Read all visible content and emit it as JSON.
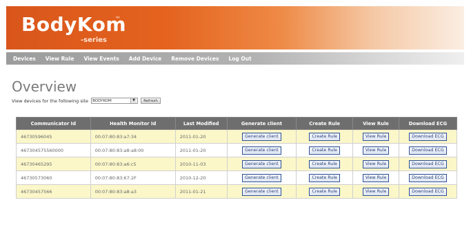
{
  "brand": {
    "name": "BodyKom",
    "trademark": "™",
    "subtitle": "-series"
  },
  "nav": [
    "Devices",
    "View Rule",
    "View Events",
    "Add Device",
    "Remove Devices",
    "Log Out"
  ],
  "page": {
    "title": "Overview"
  },
  "filter": {
    "label": "View devices for the following site",
    "site_value": "BODYKOM",
    "refresh_label": "Refresh"
  },
  "colors": {
    "header_orange": "#d9561b",
    "row_highlight": "#fbf7c9",
    "table_header": "#6e6e6e",
    "button_border": "#2d4f91"
  },
  "table": {
    "columns": [
      "Communicator Id",
      "Health Monitor Id",
      "Last Modified",
      "Generate client",
      "Create Rule",
      "View Rule",
      "Download ECG"
    ],
    "rows": [
      {
        "communicator": "46730596045",
        "monitor": "00:07:80:83:a7:34",
        "modified": "2011-01-20",
        "gen": "Generate client",
        "create": "Create Rule",
        "view": "View Rule",
        "download": "Download ECG"
      },
      {
        "communicator": "467304575560000",
        "monitor": "00:07:80:83:a8:a8:00",
        "modified": "2011-01-20",
        "gen": "Generate client",
        "create": "Create Rule",
        "view": "View Rule",
        "download": "Download ECG"
      },
      {
        "communicator": "46730465295",
        "monitor": "00:07:80:83:a6:c5",
        "modified": "2010-11-03",
        "gen": "Generate client",
        "create": "Create Rule",
        "view": "View Rule",
        "download": "Download ECG"
      },
      {
        "communicator": "46730573060",
        "monitor": "00:07:80:83:67:2F",
        "modified": "2010-12-20",
        "gen": "Generate client",
        "create": "Create Rule",
        "view": "View Rule",
        "download": "Download ECG"
      },
      {
        "communicator": "46730457566",
        "monitor": "00:07:80:83:a8:a3",
        "modified": "2011-01-21",
        "gen": "Generate client",
        "create": "Create Rule",
        "view": "View Rule",
        "download": "Download ECG"
      }
    ]
  }
}
